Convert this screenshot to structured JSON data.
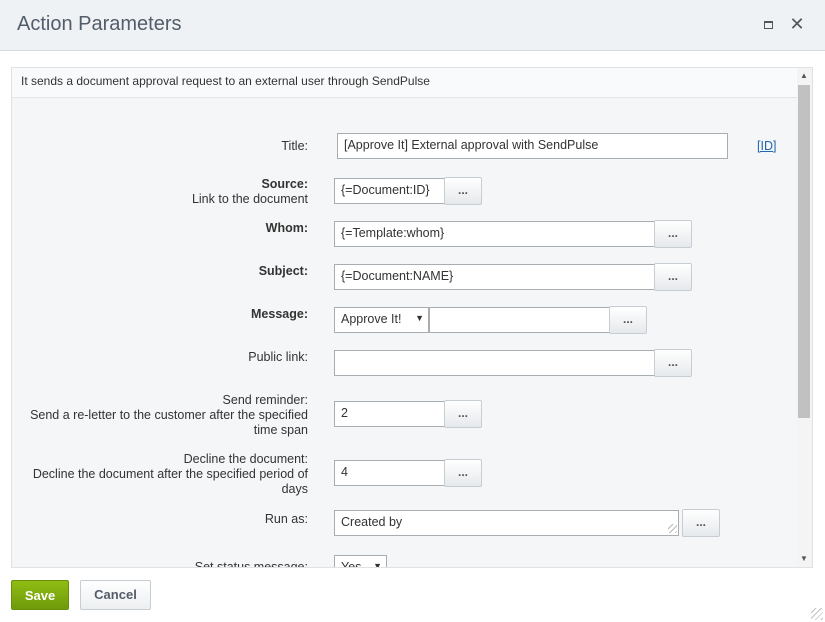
{
  "header": {
    "title": "Action Parameters"
  },
  "description": "It sends a document approval request to an external user through SendPulse",
  "form": {
    "title_label": "Title:",
    "title_value": "[Approve It] External approval with SendPulse",
    "id_link": "[ID]",
    "source_label": "Source:",
    "source_sublabel": "Link to the document",
    "source_value": "{=Document:ID}",
    "whom_label": "Whom:",
    "whom_value": "{=Template:whom}",
    "subject_label": "Subject:",
    "subject_value": "{=Document:NAME}",
    "message_label": "Message:",
    "message_select": "Approve It!",
    "message_value": "",
    "public_link_label": "Public link:",
    "public_link_value": "",
    "reminder_label": "Send reminder:",
    "reminder_sublabel": "Send a re-letter to the customer after the specified time span",
    "reminder_value": "2",
    "decline_label": "Decline the document:",
    "decline_sublabel": "Decline the document after the specified period of days",
    "decline_value": "4",
    "run_as_label": "Run as:",
    "run_as_value": "Created by",
    "status_label": "Set status message:",
    "status_select": "Yes",
    "dots_label": "..."
  },
  "footer": {
    "save_label": "Save",
    "cancel_label": "Cancel"
  },
  "colors": {
    "accent": "#7aa80e",
    "link": "#2067b0",
    "header_bg": "#eef2f4"
  }
}
